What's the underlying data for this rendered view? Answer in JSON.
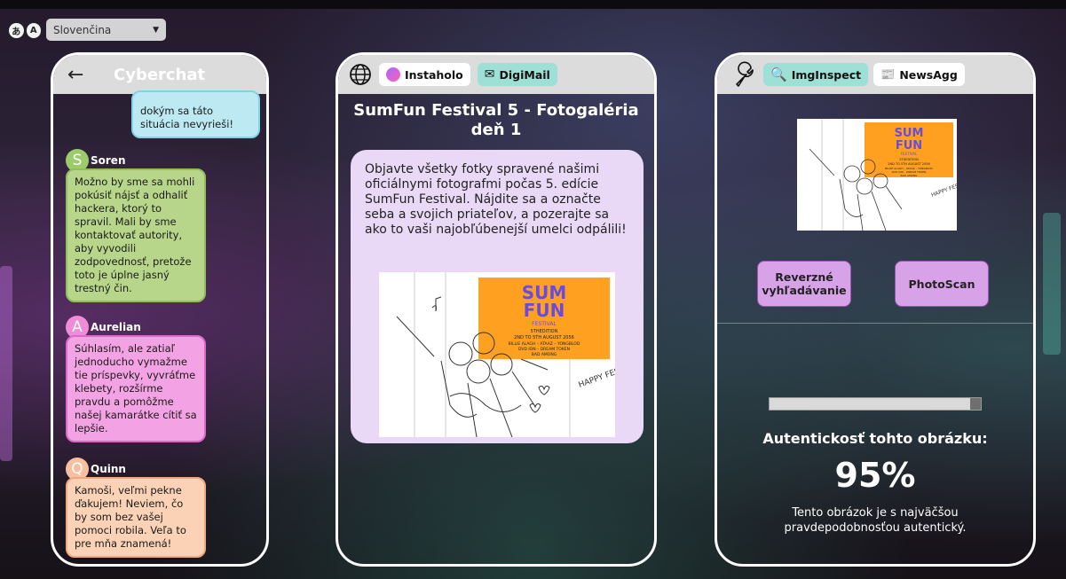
{
  "colors": {
    "panel_border": "#ffffff",
    "header_bg": "#dcdcdc",
    "self_bubble": "#bde9f3",
    "green_bubble": "#b8d68a",
    "pink_bubble": "#f3a3e4",
    "peach_bubble": "#fbd2b5",
    "post_card": "#ead8f7",
    "tool_button": "#d7a2e8",
    "teal_chip": "#9ee0d6"
  },
  "language": {
    "icon": "translate-icon",
    "selected": "Slovenčina"
  },
  "chat": {
    "title": "Cyberchat",
    "self_message": "dokým sa táto situácia nevyrieši!",
    "messages": [
      {
        "initial": "S",
        "name": "Soren",
        "avatar_color": "#9ccc6a",
        "text": "Možno by sme sa mohli pokúsiť nájsť a odhaliť hackera, ktorý to spravil. Mali by sme kontaktovať autority, aby vyvodili zodpovednosť, pretože toto je úplne jasný trestný čin."
      },
      {
        "initial": "A",
        "name": "Aurelian",
        "avatar_color": "#f08bd9",
        "text": "Súhlasím, ale zatiaľ jednoducho vymažme tie príspevky, vyvráťme klebety, rozšírme pravdu a pomôžme našej kamarátke cítiť sa lepšie."
      },
      {
        "initial": "Q",
        "name": "Quinn",
        "avatar_color": "#f7bfa0",
        "text": "Kamoši, veľmi pekne ďakujem! Neviem, čo by som bez vašej pomoci robila. Veľa to pre mňa znamená!"
      }
    ]
  },
  "browser": {
    "tabs": [
      "Instaholo",
      "DigiMail"
    ],
    "page_title_line1": "SumFun Festival 5 - Fotogaléria",
    "page_title_line2": "deň 1",
    "post_text": "Objavte všetky fotky spravené našimi oficiálnymi fotografmi počas 5. edície SumFun Festival. Nájdite sa a označte seba a svojich priateľov, a pozerajte sa ako to vaši najobľúbenejší umelci odpálili!",
    "poster": {
      "brand_line1": "SUM",
      "brand_line2": "FUN",
      "brand_line3": "FESTIVAL",
      "edition": "5THEDITION",
      "dates": "2ND TO 5TH AUGUST 2056",
      "lineup1": "BILLIE ALAGH – ATAAZ – YONGBLOD",
      "lineup2": "DVD ION – DREAM TOKEN",
      "lineup3": "BAD AMONG",
      "handwriting": "HAPPY FEST-!"
    }
  },
  "inspect": {
    "tabs": [
      "ImgInspect",
      "NewsAgg"
    ],
    "reverse_search": "Reverzné vyhľadávanie",
    "photoscan": "PhotoScan",
    "progress": 0.95,
    "auth_label": "Autentickosť tohto obrázku:",
    "auth_value": "95%",
    "auth_note": "Tento obrázok je s najväčšou pravdepodobnosťou autentický."
  }
}
